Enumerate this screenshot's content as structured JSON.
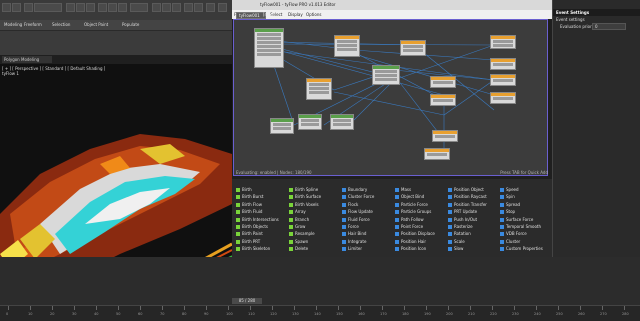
{
  "app": {
    "title": "tyFlow001 - tyFlow PRO v1.013 Editor"
  },
  "toolbar": {
    "ribbon_tabs": [
      "Modeling",
      "Freeform",
      "Selection",
      "Object Paint",
      "Populate"
    ]
  },
  "ribbon": {
    "mode": "Polygon Modeling"
  },
  "viewport": {
    "label": "[ + ] [ Perspective ] [ Standard ] [ Default Shading ]",
    "sub": "tyFlow 1"
  },
  "pflow": {
    "menu": [
      "File",
      "Edit",
      "Select",
      "Display",
      "Options"
    ],
    "tab_name": "tyFlow001",
    "tab_new": "[new]",
    "status_left": "Evaluating: enabled | Nodes: 180/190",
    "status_right": "Press TAB for Quick Add"
  },
  "depot": {
    "columns": [
      [
        "Birth",
        "Birth Burst",
        "Birth Flow",
        "Birth Fluid",
        "Birth Intersections",
        "Birth Objects",
        "Birth Paint",
        "Birth PRT",
        "Birth Skeleton"
      ],
      [
        "Birth Spline",
        "Birth Surface",
        "Birth Voxels",
        "Array",
        "Branch",
        "Grow",
        "Resample",
        "Spawn",
        "Delete"
      ],
      [
        "Boundary",
        "Cluster Force",
        "Flock",
        "Flow Update",
        "Fluid Force",
        "Force",
        "Hair Bind",
        "Integrate",
        "Limiter"
      ],
      [
        "Mass",
        "Object Bind",
        "Particle Force",
        "Particle Groups",
        "Path Follow",
        "Point Force",
        "Position Displace",
        "Position Hair",
        "Position Icon"
      ],
      [
        "Position Object",
        "Position Raycast",
        "Position Transfer",
        "PRT Update",
        "Push In/Out",
        "Rasterize",
        "Rotation",
        "Scale",
        "Slow"
      ],
      [
        "Speed",
        "Spin",
        "Spread",
        "Stop",
        "Surface Force",
        "Temporal Smooth",
        "VDB Force",
        "Cluster",
        "Custom Properties"
      ]
    ],
    "column_colors": [
      "#7ad43a",
      "#7ad43a",
      "#3a8ae0",
      "#3a8ae0",
      "#3a8ae0",
      "#3a8ae0"
    ]
  },
  "rpanel": {
    "header": "Event Settings",
    "sub": "Event settings",
    "eval_label": "Evaluation priority:",
    "eval_value": "0"
  },
  "timeline": {
    "frame": "85 / 280",
    "ticks": [
      "0",
      "10",
      "20",
      "30",
      "40",
      "50",
      "60",
      "70",
      "80",
      "90",
      "100",
      "110",
      "120",
      "130",
      "140",
      "150",
      "160",
      "170",
      "180",
      "190",
      "200",
      "210",
      "220",
      "230",
      "240",
      "250",
      "260",
      "270",
      "280"
    ]
  },
  "colors": {
    "accent": "#6a5fd0",
    "node_green": "#5a9f4a",
    "node_orange": "#e8a030"
  }
}
